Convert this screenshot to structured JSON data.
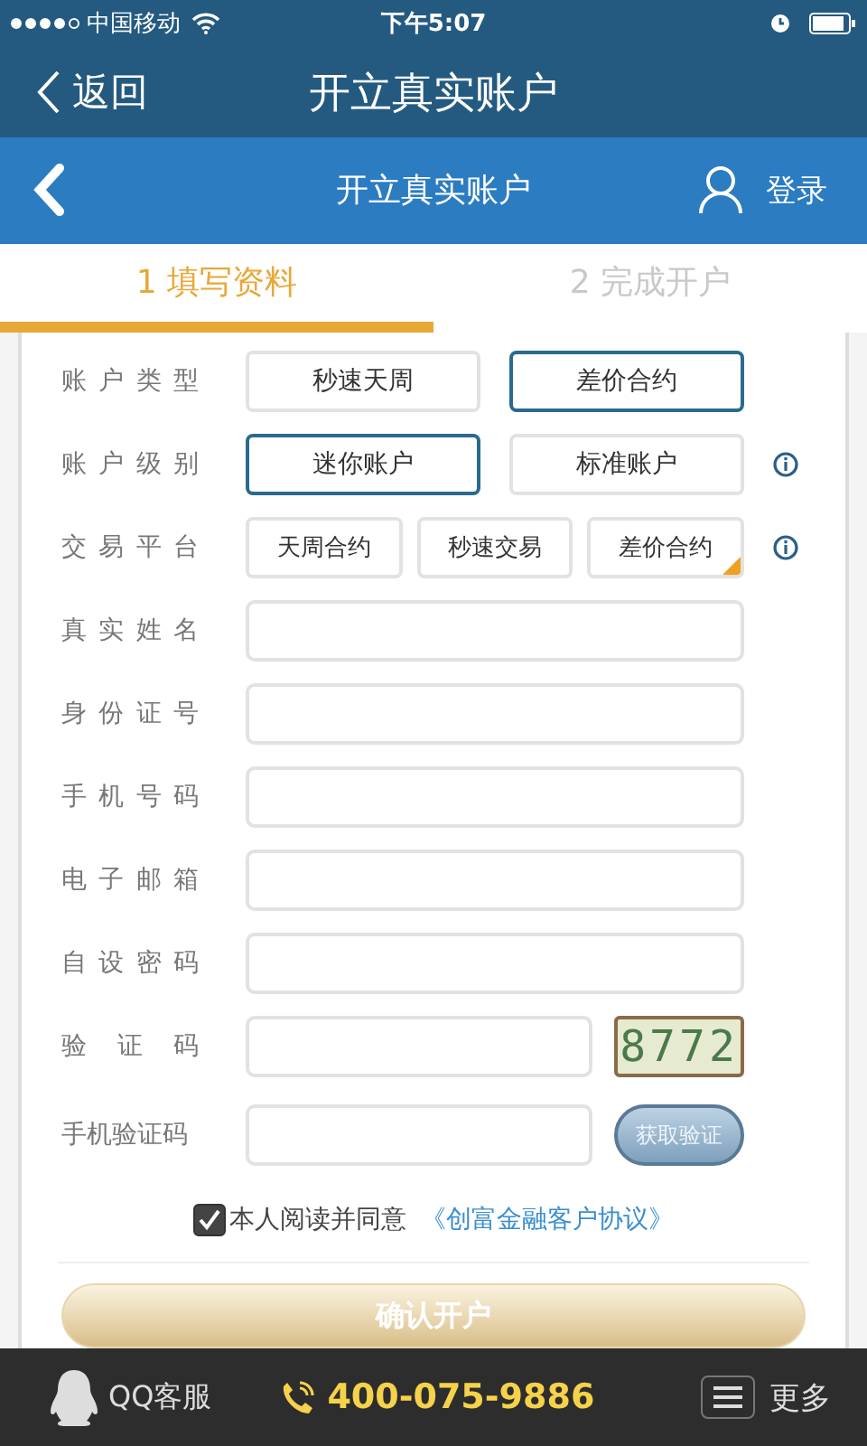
{
  "status_bar": {
    "carrier": "中国移动",
    "time": "下午5:07"
  },
  "nav_bar": {
    "back": "返回",
    "title": "开立真实账户"
  },
  "header": {
    "title": "开立真实账户",
    "login": "登录"
  },
  "steps": [
    {
      "label": "1 填写资料",
      "selected": true
    },
    {
      "label": "2 完成开户",
      "selected": false
    }
  ],
  "option_rows": [
    {
      "label": "账户类型",
      "kind": "outline",
      "info": false,
      "options": [
        {
          "label": "秒速天周",
          "selected": false
        },
        {
          "label": "差价合约",
          "selected": true
        }
      ]
    },
    {
      "label": "账户级别",
      "kind": "outline",
      "info": true,
      "options": [
        {
          "label": "迷你账户",
          "selected": true
        },
        {
          "label": "标准账户",
          "selected": false
        }
      ]
    },
    {
      "label": "交易平台",
      "kind": "corner",
      "info": true,
      "options": [
        {
          "label": "天周合约",
          "selected": false
        },
        {
          "label": "秒速交易",
          "selected": false
        },
        {
          "label": "差价合约",
          "selected": true
        }
      ]
    }
  ],
  "fields": [
    {
      "label": "真实姓名",
      "kind": "text"
    },
    {
      "label": "身份证号",
      "kind": "text"
    },
    {
      "label": "手机号码",
      "kind": "text"
    },
    {
      "label": "电子邮箱",
      "kind": "text"
    },
    {
      "label": "自设密码",
      "kind": "text"
    },
    {
      "label": "验证码",
      "kind": "captcha",
      "captcha": "8772"
    },
    {
      "label": "手机验证码",
      "kind": "sms",
      "button": "获取验证"
    }
  ],
  "agreement": {
    "checked": true,
    "text": "本人阅读并同意",
    "link": "《创富金融客户协议》"
  },
  "submit": "确认开户",
  "footer": {
    "qq": "QQ客服",
    "phone": "400-075-9886",
    "more": "更多"
  }
}
